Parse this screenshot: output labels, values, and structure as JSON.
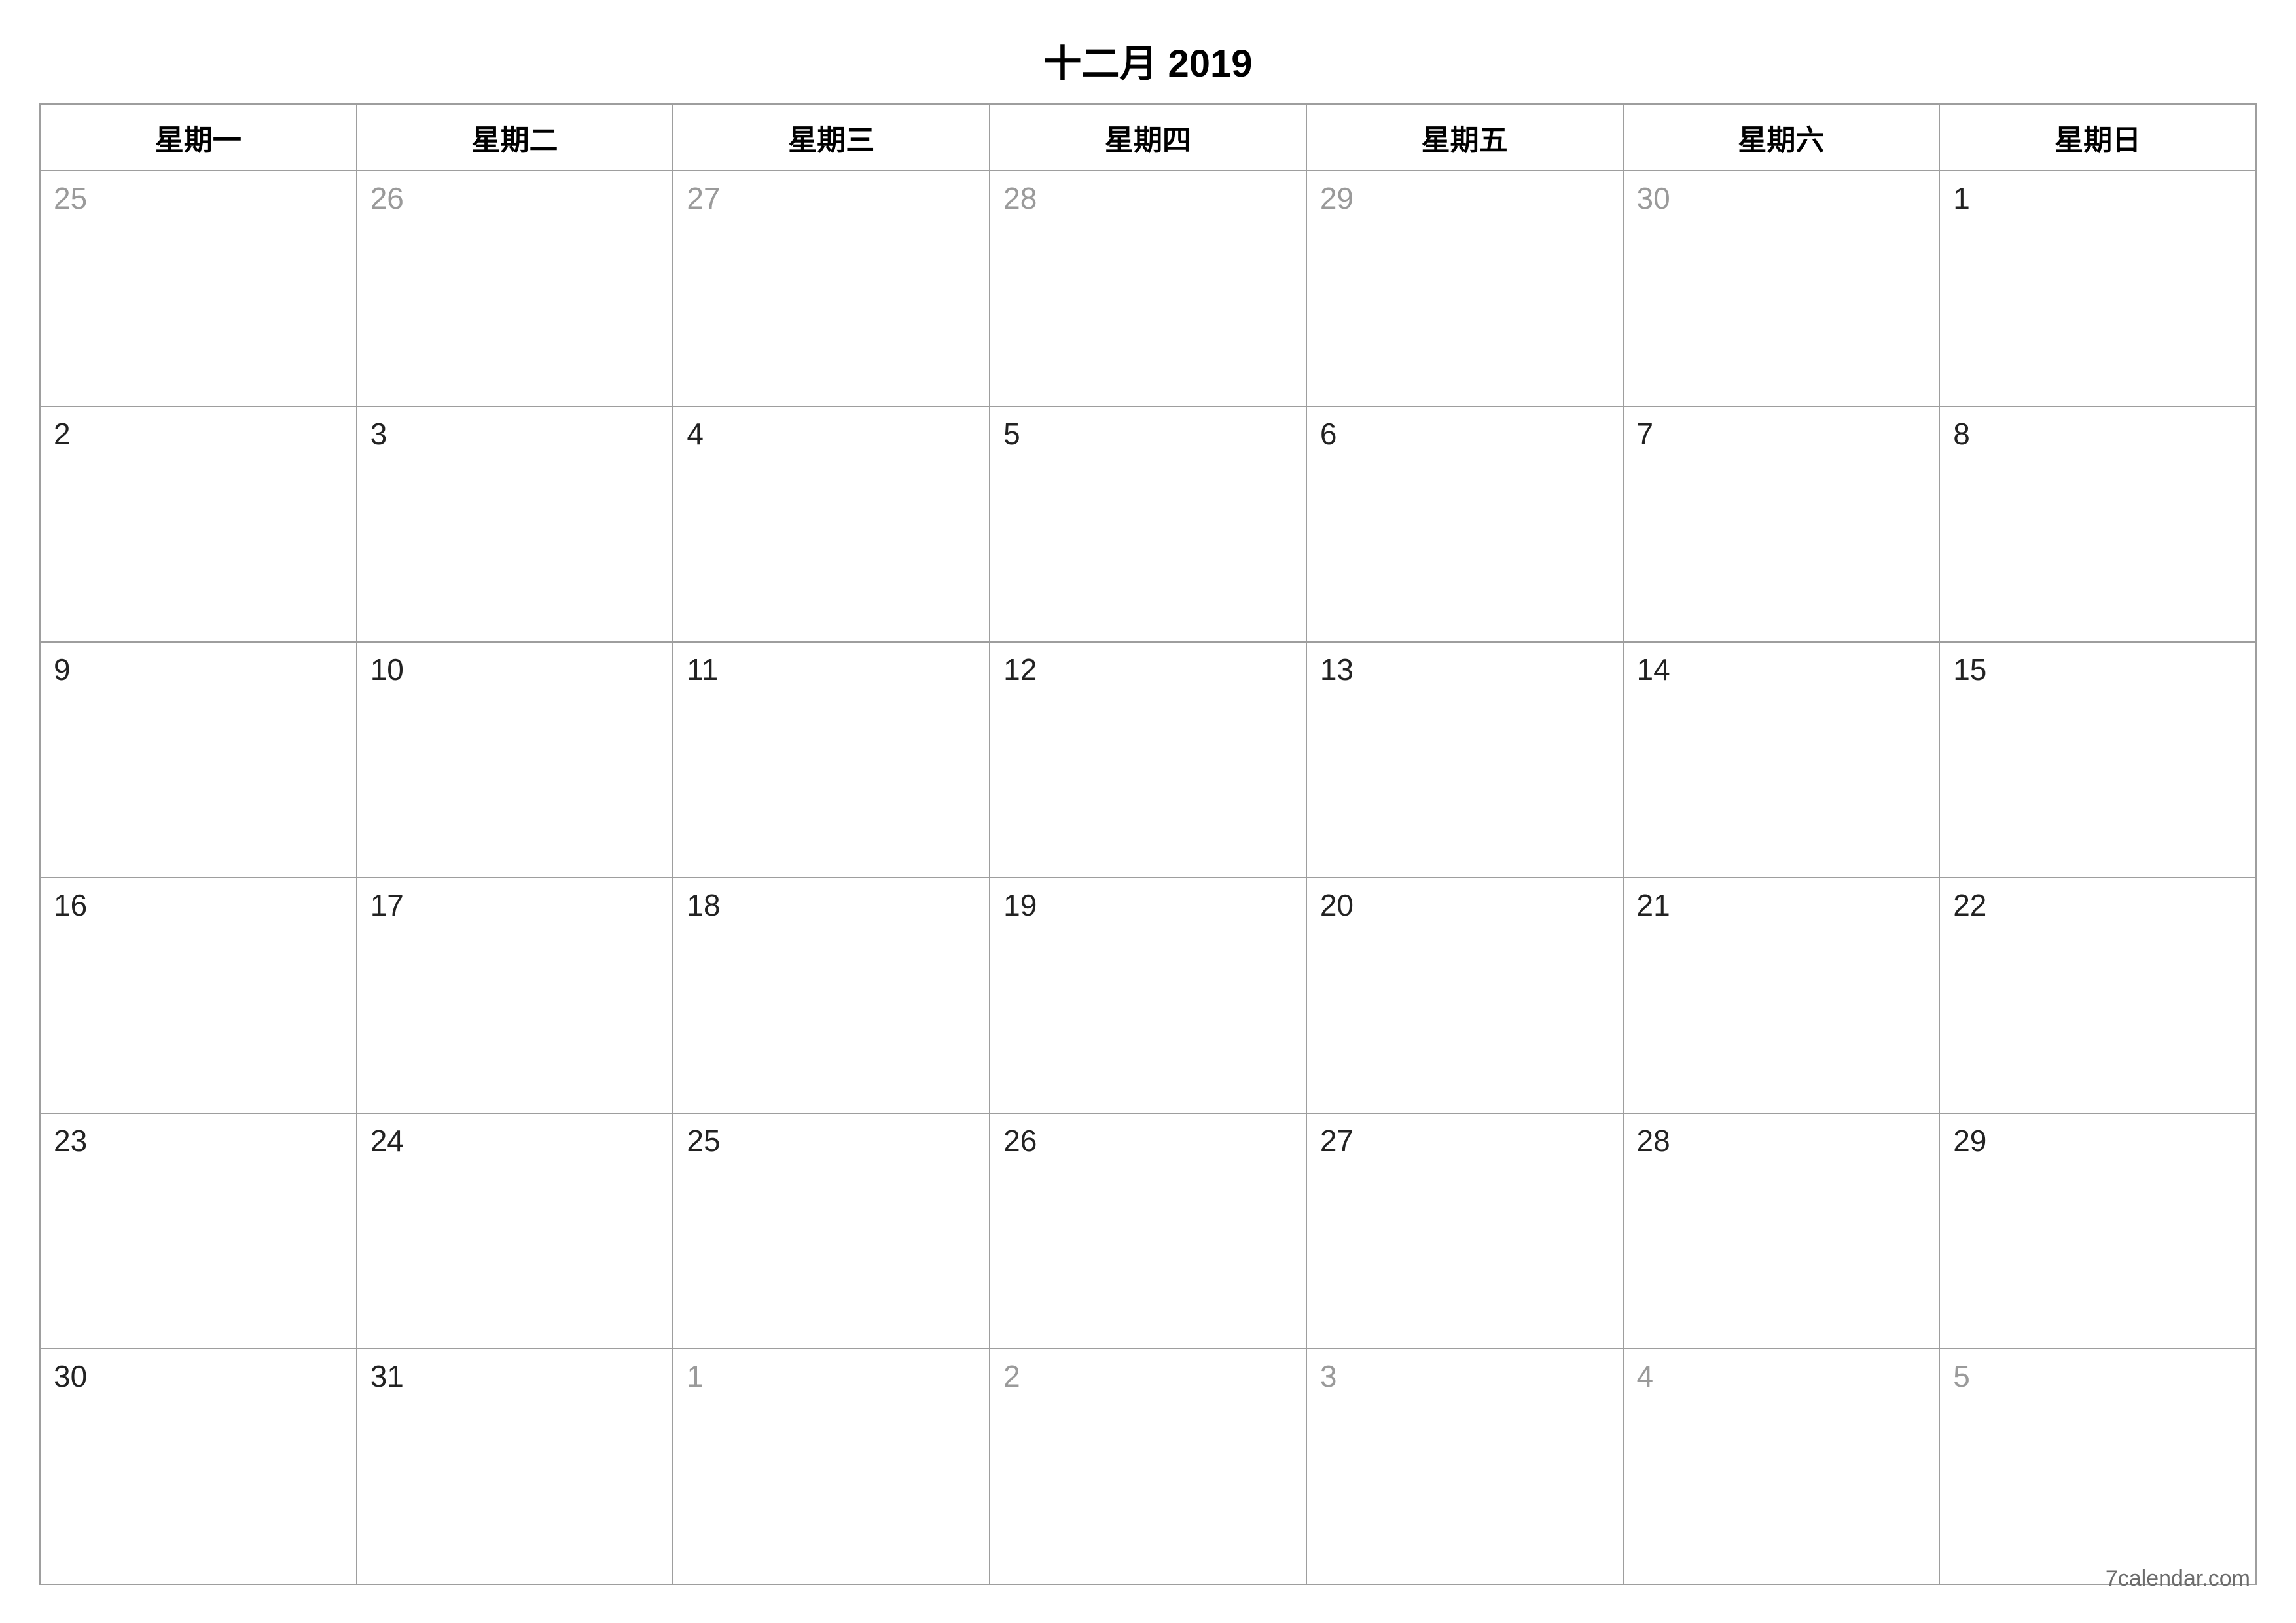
{
  "title": "十二月 2019",
  "weekdays": [
    "星期一",
    "星期二",
    "星期三",
    "星期四",
    "星期五",
    "星期六",
    "星期日"
  ],
  "weeks": [
    [
      {
        "n": "25",
        "out": true
      },
      {
        "n": "26",
        "out": true
      },
      {
        "n": "27",
        "out": true
      },
      {
        "n": "28",
        "out": true
      },
      {
        "n": "29",
        "out": true
      },
      {
        "n": "30",
        "out": true
      },
      {
        "n": "1",
        "out": false
      }
    ],
    [
      {
        "n": "2",
        "out": false
      },
      {
        "n": "3",
        "out": false
      },
      {
        "n": "4",
        "out": false
      },
      {
        "n": "5",
        "out": false
      },
      {
        "n": "6",
        "out": false
      },
      {
        "n": "7",
        "out": false
      },
      {
        "n": "8",
        "out": false
      }
    ],
    [
      {
        "n": "9",
        "out": false
      },
      {
        "n": "10",
        "out": false
      },
      {
        "n": "11",
        "out": false
      },
      {
        "n": "12",
        "out": false
      },
      {
        "n": "13",
        "out": false
      },
      {
        "n": "14",
        "out": false
      },
      {
        "n": "15",
        "out": false
      }
    ],
    [
      {
        "n": "16",
        "out": false
      },
      {
        "n": "17",
        "out": false
      },
      {
        "n": "18",
        "out": false
      },
      {
        "n": "19",
        "out": false
      },
      {
        "n": "20",
        "out": false
      },
      {
        "n": "21",
        "out": false
      },
      {
        "n": "22",
        "out": false
      }
    ],
    [
      {
        "n": "23",
        "out": false
      },
      {
        "n": "24",
        "out": false
      },
      {
        "n": "25",
        "out": false
      },
      {
        "n": "26",
        "out": false
      },
      {
        "n": "27",
        "out": false
      },
      {
        "n": "28",
        "out": false
      },
      {
        "n": "29",
        "out": false
      }
    ],
    [
      {
        "n": "30",
        "out": false
      },
      {
        "n": "31",
        "out": false
      },
      {
        "n": "1",
        "out": true
      },
      {
        "n": "2",
        "out": true
      },
      {
        "n": "3",
        "out": true
      },
      {
        "n": "4",
        "out": true
      },
      {
        "n": "5",
        "out": true
      }
    ]
  ],
  "footer": "7calendar.com"
}
